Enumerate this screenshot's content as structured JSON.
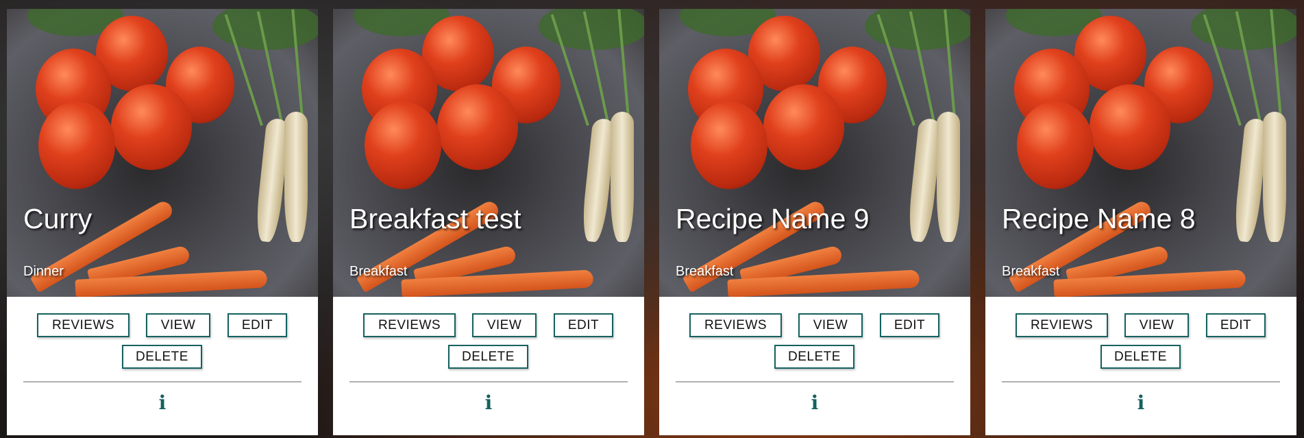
{
  "cards": [
    {
      "title": "Curry",
      "category": "Dinner"
    },
    {
      "title": "Breakfast test",
      "category": "Breakfast"
    },
    {
      "title": "Recipe Name 9",
      "category": "Breakfast"
    },
    {
      "title": "Recipe Name 8",
      "category": "Breakfast"
    }
  ],
  "buttons": {
    "reviews": "REVIEWS",
    "view": "VIEW",
    "edit": "EDIT",
    "delete": "DELETE"
  },
  "info_icon": "i",
  "colors": {
    "accent": "#14615f"
  }
}
